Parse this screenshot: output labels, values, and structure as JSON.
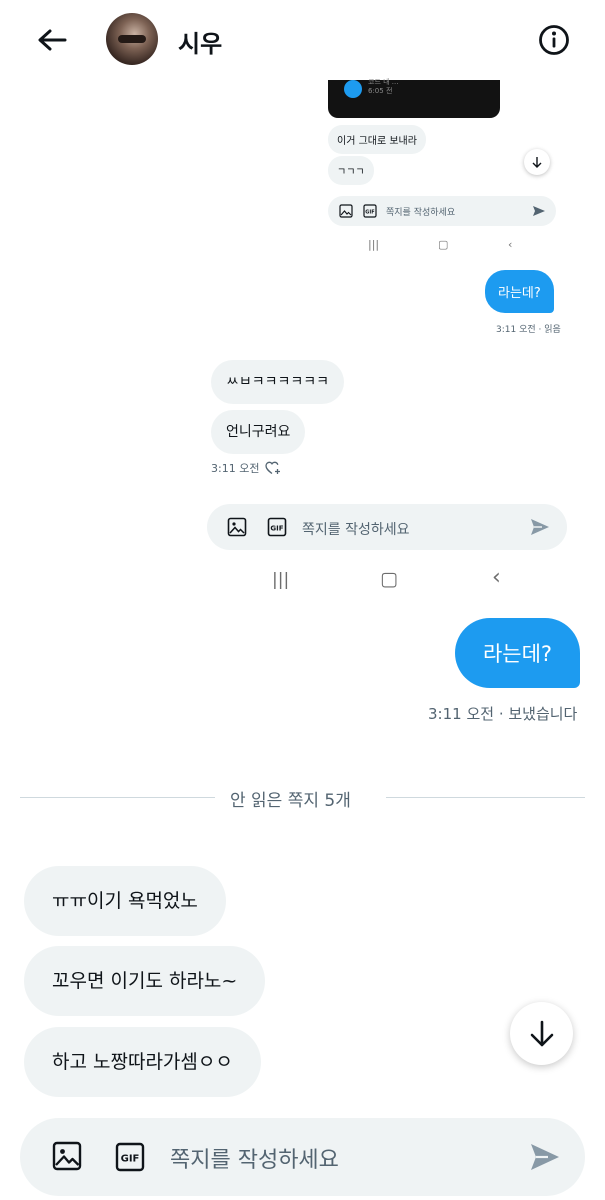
{
  "header": {
    "contact_name": "시우",
    "back_icon": "arrow-left-icon",
    "info_icon": "info-icon"
  },
  "embedded_screenshot": {
    "inner_preview": {
      "card_text_1": "코드 내 ...",
      "card_text_2": "6:05 전",
      "bubble_1": "이거 그대로 보내라",
      "bubble_2": "ㄱㄱㄱ",
      "compose_placeholder": "쪽지를 작성하세요",
      "out_bubble": "라는데?",
      "out_time": "3:11 오전 · 읽음"
    },
    "bubble_1": "ㅆㅂㅋㅋㅋㅋㅋㅋ",
    "bubble_2": "언니구려요",
    "time": "3:11 오전",
    "compose_placeholder": "쪽지를 작성하세요",
    "gif_label": "GIF"
  },
  "thread": {
    "outgoing": {
      "text": "라는데?",
      "status": "3:11 오전 · 보냈습니다"
    },
    "unread_divider": "안 읽은 쪽지 5개",
    "incoming": [
      "ㅠㅠ이기 욕먹었노",
      "꼬우면 이기도 하라노~",
      "하고 노짱따라가셈ㅇㅇ"
    ]
  },
  "composer": {
    "placeholder": "쪽지를 작성하세요",
    "gif_label": "GIF"
  },
  "colors": {
    "accent": "#1d9bf0",
    "bubble_gray": "#eff3f4",
    "muted_text": "#536471"
  }
}
